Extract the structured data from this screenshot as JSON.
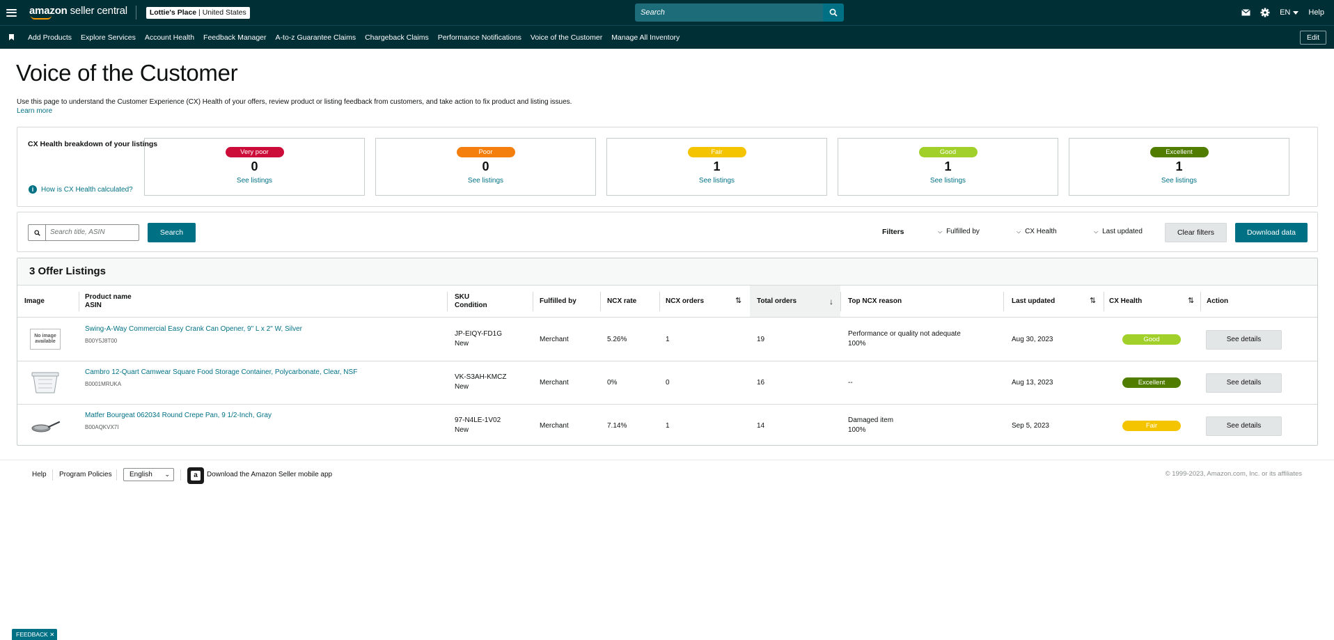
{
  "topbar": {
    "logo_amazon": "amazon",
    "logo_rest": " seller central",
    "store_name": "Lottie's Place",
    "store_region": "United States",
    "search_placeholder": "Search",
    "language": "EN",
    "help": "Help",
    "icons": [
      "hamburger-icon",
      "search-icon",
      "mail-icon",
      "gear-icon",
      "caret-down-icon"
    ]
  },
  "nav": {
    "items": [
      "Add Products",
      "Explore Services",
      "Account Health",
      "Feedback Manager",
      "A-to-z Guarantee Claims",
      "Chargeback Claims",
      "Performance Notifications",
      "Voice of the Customer",
      "Manage All Inventory"
    ],
    "edit": "Edit"
  },
  "page": {
    "title": "Voice of the Customer",
    "description": "Use this page to understand the Customer Experience (CX) Health of your offers, review product or listing feedback from customers, and take action to fix product and listing issues.",
    "learn_more": "Learn more"
  },
  "health": {
    "title": "CX Health breakdown of your listings",
    "info_link": "How is CX Health calculated?",
    "cards": [
      {
        "label": "Very poor",
        "count": "0",
        "link": "See listings",
        "color": "#cc0c39"
      },
      {
        "label": "Poor",
        "count": "0",
        "link": "See listings",
        "color": "#f47f0f"
      },
      {
        "label": "Fair",
        "count": "1",
        "link": "See listings",
        "color": "#f5c400"
      },
      {
        "label": "Good",
        "count": "1",
        "link": "See listings",
        "color": "#a2d02b"
      },
      {
        "label": "Excellent",
        "count": "1",
        "link": "See listings",
        "color": "#507d00"
      }
    ]
  },
  "filters": {
    "search_placeholder": "Search title, ASIN",
    "search_button": "Search",
    "label": "Filters",
    "dropdowns": [
      "Fulfilled by",
      "CX Health",
      "Last updated"
    ],
    "clear": "Clear filters",
    "download": "Download data"
  },
  "listings": {
    "title": "3 Offer Listings",
    "columns": {
      "image": "Image",
      "product": "Product name",
      "asin": "ASIN",
      "sku": "SKU",
      "condition": "Condition",
      "fulfilled": "Fulfilled by",
      "ncx_rate": "NCX rate",
      "ncx_orders": "NCX orders",
      "total_orders": "Total orders",
      "top_reason": "Top NCX reason",
      "last_updated": "Last updated",
      "cx_health": "CX Health",
      "action": "Action"
    },
    "rows": [
      {
        "image_alt": "No image available",
        "name": "Swing-A-Way Commercial Easy Crank Can Opener, 9\" L x 2\" W, Silver",
        "asin": "B00Y5J8T00",
        "sku": "JP-EIQY-FD1G",
        "condition": "New",
        "fulfilled": "Merchant",
        "ncx_rate": "5.26%",
        "ncx_orders": "1",
        "total_orders": "19",
        "reason": "Performance or quality not adequate",
        "reason_pct": "100%",
        "last_updated": "Aug 30, 2023",
        "health": "Good",
        "health_color": "#a2d02b",
        "action": "See details"
      },
      {
        "image_alt": "",
        "name": "Cambro 12-Quart Camwear Square Food Storage Container, Polycarbonate, Clear, NSF",
        "asin": "B0001MRUKA",
        "sku": "VK-S3AH-KMCZ",
        "condition": "New",
        "fulfilled": "Merchant",
        "ncx_rate": "0%",
        "ncx_orders": "0",
        "total_orders": "16",
        "reason": "--",
        "reason_pct": "",
        "last_updated": "Aug 13, 2023",
        "health": "Excellent",
        "health_color": "#507d00",
        "action": "See details"
      },
      {
        "image_alt": "",
        "name": "Matfer Bourgeat 062034 Round Crepe Pan, 9 1/2-Inch, Gray",
        "asin": "B00AQKVX7I",
        "sku": "97-N4LE-1V02",
        "condition": "New",
        "fulfilled": "Merchant",
        "ncx_rate": "7.14%",
        "ncx_orders": "1",
        "total_orders": "14",
        "reason": "Damaged item",
        "reason_pct": "100%",
        "last_updated": "Sep 5, 2023",
        "health": "Fair",
        "health_color": "#f5c400",
        "action": "See details"
      }
    ]
  },
  "footer": {
    "help": "Help",
    "policies": "Program Policies",
    "language": "English",
    "app": "Download the Amazon Seller mobile app",
    "copyright": "© 1999-2023, Amazon.com, Inc. or its affiliates"
  },
  "feedback": "FEEDBACK"
}
